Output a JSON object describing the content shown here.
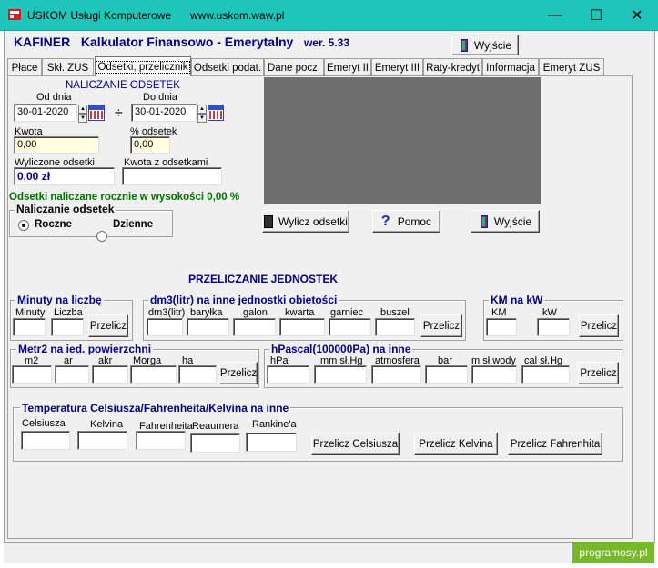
{
  "window": {
    "company": "USKOM Usługi Komputerowe",
    "url": "www.uskom.waw.pl",
    "minimize": "—",
    "maximize": "☐",
    "close": "✕"
  },
  "header": {
    "app_name": "KAFINER",
    "app_title": "Kalkulator Finansowo - Emerytalny",
    "version": "wer. 5.33",
    "exit_label": "Wyjście"
  },
  "tabs": [
    "Płace",
    "Skł. ZUS",
    "Odsetki, przelicznik",
    "Odsetki podat.",
    "Dane pocz.",
    "Emeryt II",
    "Emeryt III",
    "Raty-kredyt",
    "Informacja",
    "Emeryt ZUS"
  ],
  "active_tab": 2,
  "interest": {
    "section_title": "NALICZANIE ODSETEK",
    "from_label": "Od dnia",
    "to_label": "Do dnia",
    "from_value": "30-01-2020",
    "to_value": "30-01-2020",
    "divider": "÷",
    "amount_label": "Kwota",
    "amount_value": "0,00",
    "percent_label": "% odsetek",
    "percent_value": "0,00",
    "calculated_label": "Wyliczone odsetki",
    "calculated_value": "0,00 zł",
    "total_label": "Kwota z odsetkami",
    "total_value": "",
    "info_text": "Odsetki naliczane rocznie w wysokości 0,00 %",
    "mode_group": "Naliczanie odsetek",
    "mode_yearly": "Roczne",
    "mode_daily": "Dzienne",
    "calc_button": "Wylicz odsetki",
    "help_button": "Pomoc",
    "exit_button": "Wyjście"
  },
  "converter": {
    "section_title": "PRZELICZANIE JEDNOSTEK",
    "minutes": {
      "title": "Minuty na liczbę",
      "labels": [
        "Minuty",
        "Liczba"
      ],
      "button": "Przelicz"
    },
    "volume": {
      "title": "dm3(litr) na inne jednostki obietości",
      "labels": [
        "dm3(litr)",
        "baryłka",
        "galon",
        "kwarta",
        "garniec",
        "buszel"
      ],
      "button": "Przelicz"
    },
    "power": {
      "title": "KM na kW",
      "labels": [
        "KM",
        "kW"
      ],
      "button": "Przelicz"
    },
    "area": {
      "title": "Metr2 na ied. powierzchni",
      "labels": [
        "m2",
        "ar",
        "akr",
        "Morga",
        "ha"
      ],
      "button": "Przelicz"
    },
    "pressure": {
      "title": "hPascal(100000Pa) na inne",
      "labels": [
        "hPa",
        "mm sł.Hg",
        "atmosfera",
        "bar",
        "m sł.wody",
        "cal sł.Hg"
      ],
      "button": "Przelicz"
    },
    "temperature": {
      "title": "Temperatura Celsiusza/Fahrenheita/Kelvina na inne",
      "labels": [
        "Celsiusza",
        "Kelvina",
        "Fahrenheita",
        "Reaumera",
        "Rankine'a"
      ],
      "buttons": [
        "Przelicz Celsiusza",
        "Przelicz Kelvina",
        "Przelicz Fahrenhita"
      ]
    }
  },
  "watermark": "programosy.pl"
}
